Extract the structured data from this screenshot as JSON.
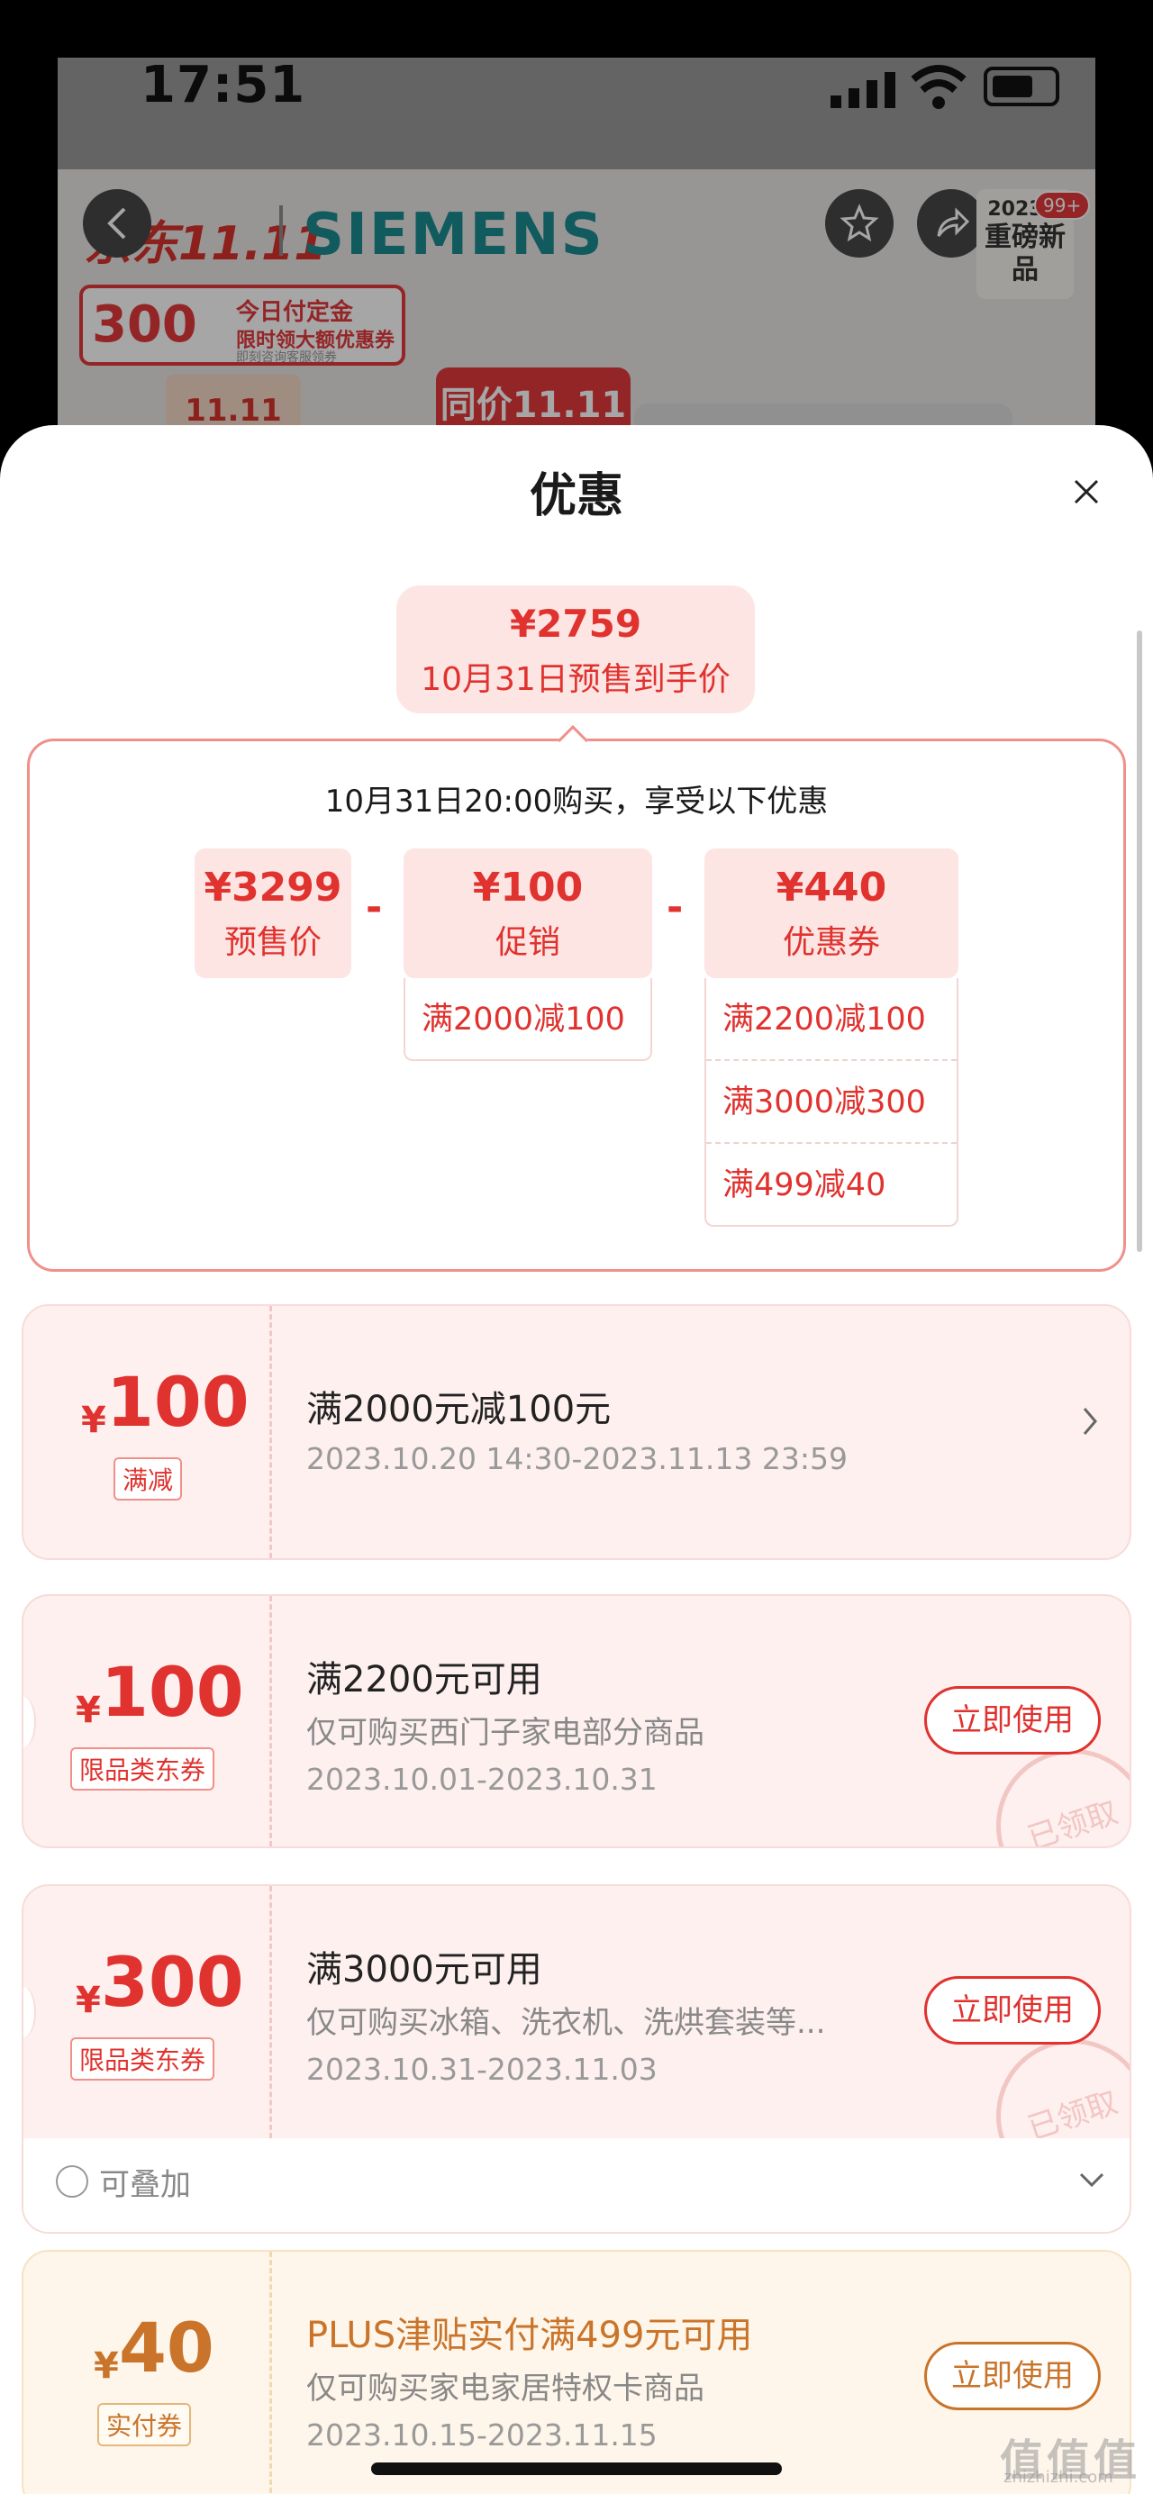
{
  "status_bar": {
    "time": "17:51"
  },
  "product_page": {
    "brand_jd": "京东11.11",
    "brand_siemens": "SIEMENS",
    "ranking_year": "2023年",
    "ranking_text": "重磅新品",
    "cart_count": "99+",
    "promo_amount": "300",
    "promo_title": "今日付定金",
    "promo_sub": "限时领大额优惠券",
    "promo_sub2": "即刻咨询客服领券",
    "sale_logo": "11.11",
    "same_price": "同价11.11"
  },
  "sheet": {
    "title": "优惠",
    "final_price": "¥2759",
    "final_price_label": "10月31日预售到手价",
    "purchase_note": "10月31日20:00购买，享受以下优惠",
    "calc": {
      "presale": {
        "amount": "¥3299",
        "label": "预售价"
      },
      "promo": {
        "amount": "¥100",
        "label": "促销",
        "details": [
          "满2000减100"
        ]
      },
      "coupon": {
        "amount": "¥440",
        "label": "优惠券",
        "details": [
          "满2200减100",
          "满3000减300",
          "满499减40"
        ]
      },
      "minus": "-"
    }
  },
  "coupons": [
    {
      "yuan": "¥",
      "amount": "100",
      "tag": "满减",
      "title": "满2000元减100元",
      "desc": "",
      "date": "2023.10.20 14:30-2023.11.13 23:59",
      "button": ""
    },
    {
      "yuan": "¥",
      "amount": "100",
      "tag": "限品类东券",
      "title": "满2200元可用",
      "desc": "仅可购买西门子家电部分商品",
      "date": "2023.10.01-2023.10.31",
      "button": "立即使用",
      "stamp": "已领取"
    },
    {
      "yuan": "¥",
      "amount": "300",
      "tag": "限品类东券",
      "title": "满3000元可用",
      "desc": "仅可购买冰箱、洗衣机、洗烘套装等...",
      "date": "2023.10.31-2023.11.03",
      "button": "立即使用",
      "stamp": "已领取",
      "stack_label": "可叠加"
    },
    {
      "yuan": "¥",
      "amount": "40",
      "tag": "实付券",
      "title": "PLUS津贴实付满499元可用",
      "desc": "仅可购买家电家居特权卡商品",
      "date": "2023.10.15-2023.11.15",
      "button": "立即使用"
    }
  ],
  "watermark": {
    "main": "值值值",
    "sub": "zhizhizhi.com"
  },
  "colors": {
    "accent": "#e0322e",
    "coupon_bg": "#fdf0ef",
    "plus_bg": "#fef6ea",
    "plus_text": "#c9742a"
  }
}
